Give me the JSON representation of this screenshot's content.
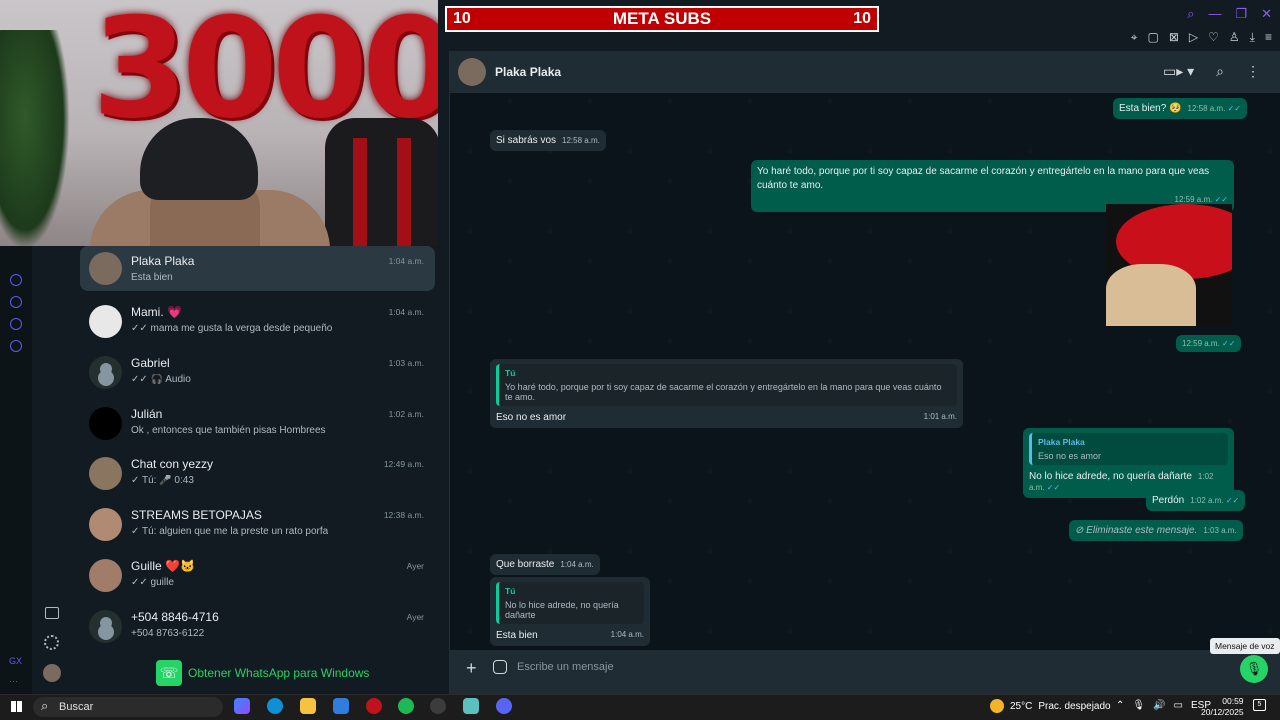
{
  "stream_banner": {
    "left_count": "10",
    "title": "META SUBS",
    "right_count": "10"
  },
  "webcam": {
    "balloon_text": "3000"
  },
  "chats": [
    {
      "name": "Plaka Plaka",
      "time": "1:04 a.m.",
      "last": "Esta bien",
      "active": true,
      "avatar": "photo"
    },
    {
      "name": "Mami. 💗",
      "time": "1:04 a.m.",
      "last": "✓✓ mama me gusta la verga desde pequeño",
      "avatar": "photo"
    },
    {
      "name": "Gabriel",
      "time": "1:03 a.m.",
      "last": "✓✓ 🎧 Audio",
      "avatar": "default"
    },
    {
      "name": "Julián",
      "time": "1:02 a.m.",
      "last": "Ok , entonces que también pisas Hombrees",
      "avatar": "photo"
    },
    {
      "name": "Chat con yezzy",
      "time": "12:49 a.m.",
      "last": "✓ Tú: 🎤 0:43",
      "avatar": "photo"
    },
    {
      "name": "STREAMS BETOPAJAS",
      "time": "12:38 a.m.",
      "last": "✓ Tú: alguien que me la preste un rato porfa",
      "avatar": "photo"
    },
    {
      "name": "Guille ❤️🐱",
      "time": "Ayer",
      "last": "✓✓ guille",
      "avatar": "photo"
    },
    {
      "name": "+504 8846-4716",
      "time": "Ayer",
      "last": "+504 8763-6122",
      "avatar": "default"
    }
  ],
  "get_whatsapp": "Obtener WhatsApp para Windows",
  "conversation": {
    "contact": "Plaka Plaka",
    "messages": [
      {
        "id": "m1",
        "text": "Esta bien? 🥺",
        "time": "12:58 a.m."
      },
      {
        "id": "m2",
        "text": "Si sabrás vos",
        "time": "12:58 a.m."
      },
      {
        "id": "m3",
        "text": "Yo haré todo, porque por ti soy capaz de sacarme el corazón y entregártelo en la mano para que veas cuánto te amo.",
        "time": "12:59 a.m."
      },
      {
        "id": "m4",
        "text": "",
        "time": "12:59 a.m."
      },
      {
        "id": "m5",
        "quote_author": "Tú",
        "quote_text": "Yo haré todo, porque por ti soy capaz de sacarme el corazón y entregártelo en la mano para que veas cuánto te amo.",
        "text": "Eso no es amor",
        "time": "1:01 a.m."
      },
      {
        "id": "m6",
        "quote_author": "Plaka Plaka",
        "quote_text": "Eso no es amor",
        "text": "No lo hice adrede, no quería dañarte",
        "time": "1:02 a.m."
      },
      {
        "id": "m7",
        "text": "Perdón",
        "time": "1:02 a.m."
      },
      {
        "id": "m8",
        "text": "Eliminaste este mensaje.",
        "time": "1:03 a.m."
      },
      {
        "id": "m9",
        "text": "Que borraste",
        "time": "1:04 a.m."
      },
      {
        "id": "m10",
        "quote_author": "Tú",
        "quote_text": "No lo hice adrede, no quería dañarte",
        "text": "Esta bien",
        "time": "1:04 a.m."
      }
    ]
  },
  "composer": {
    "placeholder": "Escribe un mensaje",
    "tooltip": "Mensaje de voz"
  },
  "taskbar": {
    "search": "Buscar",
    "weather_temp": "25°C",
    "weather_desc": "Prac. despejado",
    "lang": "ESP",
    "time": "00:59",
    "date": "20/12/2025",
    "notifications": "5"
  },
  "colors": {
    "accent": "#25d366",
    "out_bubble": "#005c4b",
    "in_bubble": "#202c33",
    "banner": "#c00000"
  }
}
